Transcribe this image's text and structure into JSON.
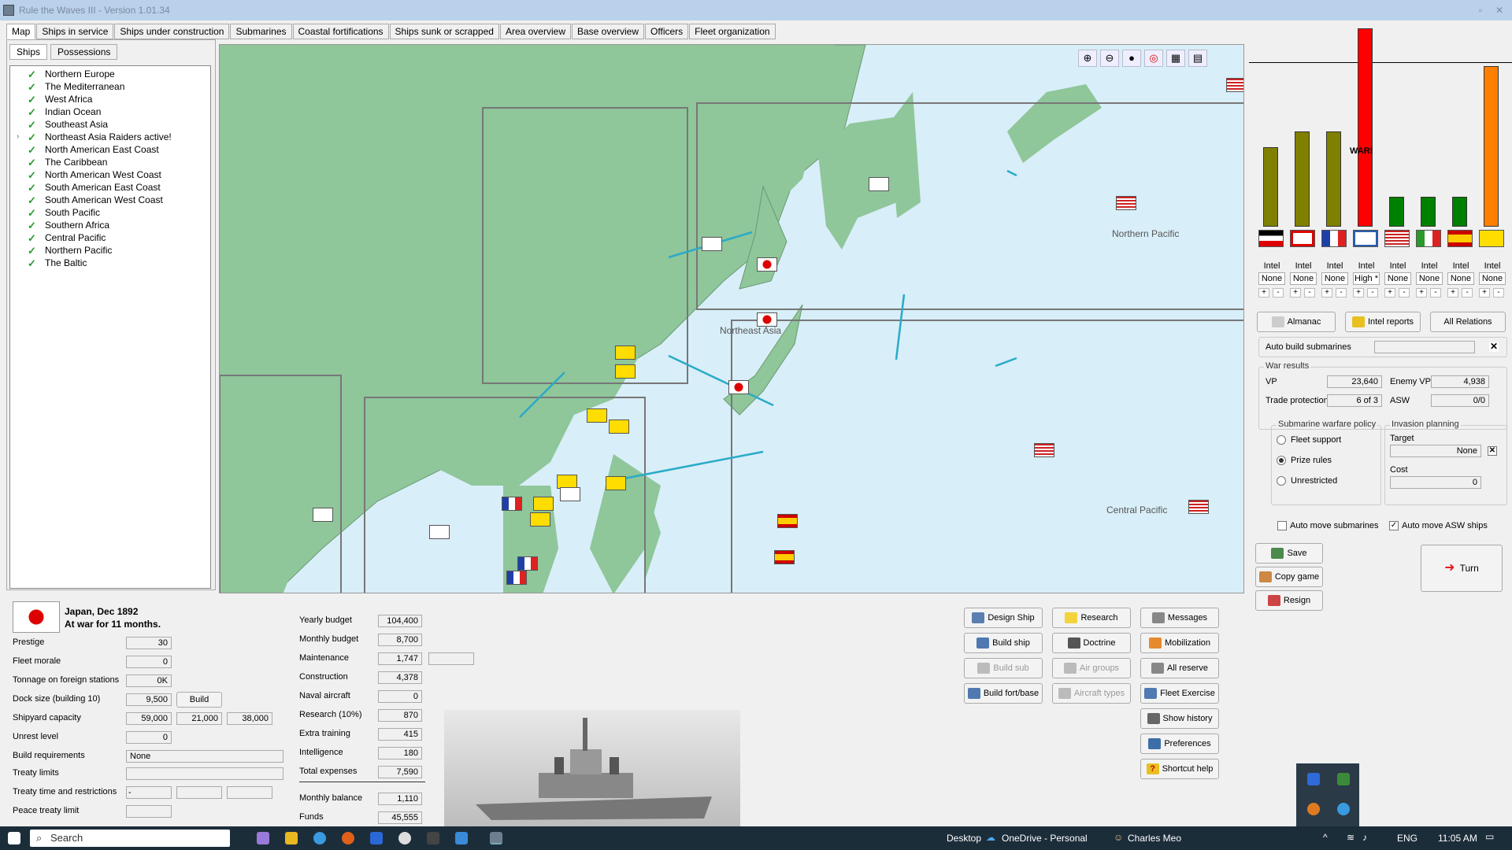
{
  "window": {
    "title": "Rule the Waves III - Version 1.01.34"
  },
  "tabs": [
    "Map",
    "Ships in service",
    "Ships under construction",
    "Submarines",
    "Coastal fortifications",
    "Ships sunk or scrapped",
    "Area overview",
    "Base overview",
    "Officers",
    "Fleet organization"
  ],
  "subtabs": [
    "Ships",
    "Possessions"
  ],
  "regions": [
    "Northern Europe",
    "The Mediterranean",
    "West Africa",
    "Indian Ocean",
    "Southeast Asia",
    "Northeast Asia Raiders active!",
    "North American East Coast",
    "The Caribbean",
    "North American West Coast",
    "South American East Coast",
    "South American West Coast",
    "South Pacific",
    "Southern Africa",
    "Central Pacific",
    "Northern Pacific",
    "The Baltic"
  ],
  "map": {
    "labels": {
      "northeast_asia": "Northeast Asia",
      "northern_pacific": "Northern Pacific",
      "central_pacific": "Central Pacific"
    }
  },
  "nation": {
    "title": "Japan, Dec 1892",
    "status": "At war for 11 months."
  },
  "stats": {
    "prestige_label": "Prestige",
    "prestige": "30",
    "morale_label": "Fleet morale",
    "morale": "0",
    "tonnage_label": "Tonnage on foreign stations",
    "tonnage": "0K",
    "dock_label": "Dock size (building 10)",
    "dock": "9,500",
    "build_btn": "Build",
    "shipyard_label": "Shipyard capacity",
    "shipyard1": "59,000",
    "shipyard2": "21,000",
    "shipyard3": "38,000",
    "unrest_label": "Unrest level",
    "unrest": "0",
    "buildreq_label": "Build requirements",
    "buildreq": "None",
    "treaty_label": "Treaty limits",
    "treatytime_label": "Treaty time and restrictions",
    "treatytime": "-",
    "peace_label": "Peace treaty limit"
  },
  "budget": {
    "yearly_label": "Yearly budget",
    "yearly": "104,400",
    "monthly_label": "Monthly budget",
    "monthly": "8,700",
    "maint_label": "Maintenance",
    "maint": "1,747",
    "constr_label": "Construction",
    "constr": "4,378",
    "aircraft_label": "Naval aircraft",
    "aircraft": "0",
    "research_label": "Research (10%)",
    "research": "870",
    "training_label": "Extra training",
    "training": "415",
    "intel_label": "Intelligence",
    "intel": "180",
    "total_label": "Total expenses",
    "total": "7,590",
    "balance_label": "Monthly balance",
    "balance": "1,110",
    "funds_label": "Funds",
    "funds": "45,555"
  },
  "actions": {
    "design_ship": "Design Ship",
    "research": "Research",
    "messages": "Messages",
    "build_ship": "Build ship",
    "doctrine": "Doctrine",
    "mobilization": "Mobilization",
    "build_sub": "Build sub",
    "air_groups": "Air groups",
    "all_reserve": "All reserve",
    "build_fort": "Build fort/base",
    "aircraft_types": "Aircraft types",
    "fleet_exercise": "Fleet Exercise",
    "show_history": "Show history",
    "preferences": "Preferences",
    "shortcut_help": "Shortcut help"
  },
  "relations": {
    "war_label": "WAR!",
    "intel_label": "Intel",
    "levels": [
      0.4,
      0.48,
      0.48,
      1.0,
      0.15,
      0.15,
      0.15,
      0.81
    ],
    "colors": [
      "#808000",
      "#808000",
      "#808000",
      "#ff0000",
      "#008000",
      "#008000",
      "#008000",
      "#ff8000"
    ],
    "intel_values": [
      "None",
      "None",
      "None",
      "High *",
      "None",
      "None",
      "None",
      "None"
    ],
    "plus": "+",
    "minus": "-"
  },
  "right": {
    "almanac": "Almanac",
    "intel_reports": "Intel reports",
    "all_relations": "All Relations",
    "auto_build_subs": "Auto build submarines",
    "war_results": "War results",
    "vp_label": "VP",
    "vp": "23,640",
    "enemy_vp_label": "Enemy VP",
    "enemy_vp": "4,938",
    "trade_label": "Trade protection",
    "trade": "6 of 3",
    "asw_label": "ASW",
    "asw": "0/0",
    "sub_policy": "Submarine warfare policy",
    "fleet_support": "Fleet support",
    "prize_rules": "Prize rules",
    "unrestricted": "Unrestricted",
    "invasion": "Invasion planning",
    "target_label": "Target",
    "target": "None",
    "cost_label": "Cost",
    "cost": "0",
    "auto_move_subs": "Auto move submarines",
    "auto_move_asw": "Auto move ASW ships",
    "save": "Save",
    "copy_game": "Copy game",
    "resign": "Resign",
    "turn": "Turn"
  },
  "taskbar": {
    "search": "Search",
    "desktop": "Desktop",
    "onedrive": "OneDrive - Personal",
    "user": "Charles Meo",
    "lang": "ENG",
    "time": "11:05 AM"
  }
}
